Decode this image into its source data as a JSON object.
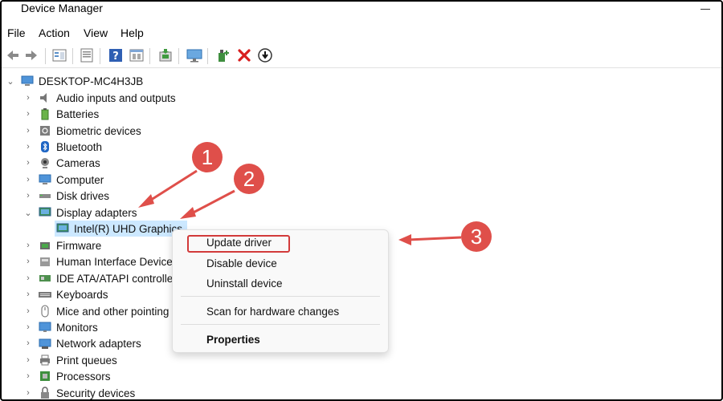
{
  "window": {
    "title": "Device Manager"
  },
  "menu": [
    "File",
    "Action",
    "View",
    "Help"
  ],
  "toolbar_icons": [
    "back-arrow-icon",
    "forward-arrow-icon",
    "device-tree-icon",
    "properties-sheet-icon",
    "help-question-icon",
    "view-list-icon",
    "update-driver-icon",
    "monitor-scan-icon",
    "add-driver-icon",
    "uninstall-x-icon",
    "download-driver-icon"
  ],
  "tree": {
    "root": "DESKTOP-MC4H3JB",
    "items": [
      {
        "label": "Audio inputs and outputs",
        "icon": "speaker-icon"
      },
      {
        "label": "Batteries",
        "icon": "battery-icon"
      },
      {
        "label": "Biometric devices",
        "icon": "fingerprint-icon"
      },
      {
        "label": "Bluetooth",
        "icon": "bluetooth-icon"
      },
      {
        "label": "Cameras",
        "icon": "camera-icon"
      },
      {
        "label": "Computer",
        "icon": "computer-icon"
      },
      {
        "label": "Disk drives",
        "icon": "disk-drive-icon"
      },
      {
        "label": "Display adapters",
        "icon": "display-adapter-icon"
      },
      {
        "label": "Intel(R) UHD Graphics",
        "icon": "display-adapter-icon"
      },
      {
        "label": "Firmware",
        "icon": "firmware-icon"
      },
      {
        "label": "Human Interface Devices",
        "icon": "hid-icon"
      },
      {
        "label": "IDE ATA/ATAPI controllers",
        "icon": "ide-controller-icon"
      },
      {
        "label": "Keyboards",
        "icon": "keyboard-icon"
      },
      {
        "label": "Mice and other pointing devices",
        "icon": "mouse-icon"
      },
      {
        "label": "Monitors",
        "icon": "monitor-icon"
      },
      {
        "label": "Network adapters",
        "icon": "network-adapter-icon"
      },
      {
        "label": "Print queues",
        "icon": "printer-icon"
      },
      {
        "label": "Processors",
        "icon": "processor-icon"
      },
      {
        "label": "Security devices",
        "icon": "security-device-icon"
      }
    ]
  },
  "context_menu": {
    "update": "Update driver",
    "disable": "Disable device",
    "uninstall": "Uninstall device",
    "scan": "Scan for hardware changes",
    "properties": "Properties"
  },
  "annotations": [
    "1",
    "2",
    "3"
  ],
  "colors": {
    "annotation_red": "#df4f4a",
    "selection": "#cce8ff",
    "highlight_border": "#d23a3a"
  }
}
